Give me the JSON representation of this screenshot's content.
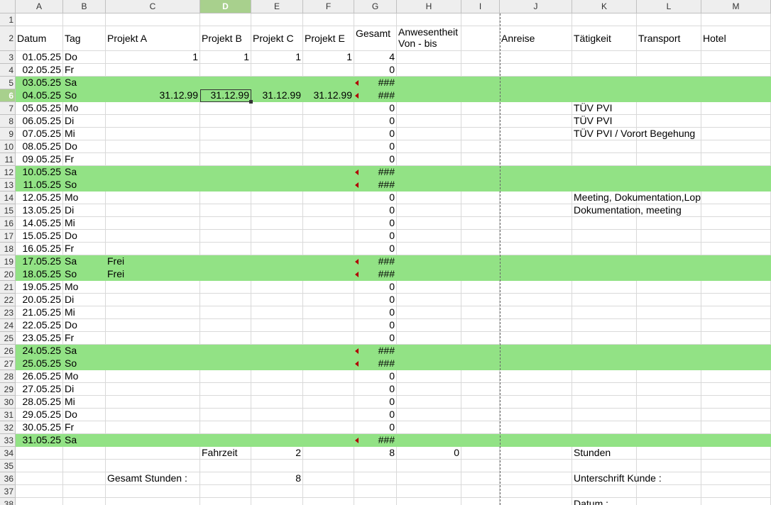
{
  "columns": [
    "A",
    "B",
    "C",
    "D",
    "E",
    "F",
    "G",
    "H",
    "I",
    "J",
    "K",
    "L",
    "M"
  ],
  "selected_column": "D",
  "selected_row": "6",
  "header_row": {
    "datum": "Datum",
    "tag": "Tag",
    "proj_a": "Projekt A",
    "proj_b": "Projekt B",
    "proj_c": "Projekt C",
    "proj_e": "Projekt E",
    "gesamt": "Gesamt",
    "anwesenheit": "Anwesentheit",
    "von_bis": "Von - bis",
    "anreise": "Anreise",
    "taetigkeit": "Tätigkeit",
    "transport": "Transport",
    "hotel": "Hotel"
  },
  "rows": [
    {
      "n": "1"
    },
    {
      "n": "2"
    },
    {
      "n": "3",
      "date": "01.05.25",
      "day": "Do",
      "a": "1",
      "b": "1",
      "c": "1",
      "e": "1",
      "g": "4"
    },
    {
      "n": "4",
      "date": "02.05.25",
      "day": "Fr",
      "g": "0"
    },
    {
      "n": "5",
      "date": "03.05.25",
      "day": "Sa",
      "g": "###",
      "weekend": true
    },
    {
      "n": "6",
      "date": "04.05.25",
      "day": "So",
      "a": "31.12.99",
      "b": "31.12.99",
      "c": "31.12.99",
      "e": "31.12.99",
      "g": "###",
      "weekend": true
    },
    {
      "n": "7",
      "date": "05.05.25",
      "day": "Mo",
      "g": "0",
      "k": "TÜV PVI"
    },
    {
      "n": "8",
      "date": "06.05.25",
      "day": "Di",
      "g": "0",
      "k": "TÜV PVI"
    },
    {
      "n": "9",
      "date": "07.05.25",
      "day": "Mi",
      "g": "0",
      "k": "TÜV PVI / Vorort Begehung"
    },
    {
      "n": "10",
      "date": "08.05.25",
      "day": "Do",
      "g": "0"
    },
    {
      "n": "11",
      "date": "09.05.25",
      "day": "Fr",
      "g": "0"
    },
    {
      "n": "12",
      "date": "10.05.25",
      "day": "Sa",
      "g": "###",
      "weekend": true
    },
    {
      "n": "13",
      "date": "11.05.25",
      "day": "So",
      "g": "###",
      "weekend": true
    },
    {
      "n": "14",
      "date": "12.05.25",
      "day": "Mo",
      "g": "0",
      "k": "Meeting, Dokumentation,Lop"
    },
    {
      "n": "15",
      "date": "13.05.25",
      "day": "Di",
      "g": "0",
      "k": "Dokumentation, meeting"
    },
    {
      "n": "16",
      "date": "14.05.25",
      "day": "Mi",
      "g": "0"
    },
    {
      "n": "17",
      "date": "15.05.25",
      "day": "Do",
      "g": "0"
    },
    {
      "n": "18",
      "date": "16.05.25",
      "day": "Fr",
      "g": "0"
    },
    {
      "n": "19",
      "date": "17.05.25",
      "day": "Sa",
      "a_text": "Frei",
      "g": "###",
      "weekend": true
    },
    {
      "n": "20",
      "date": "18.05.25",
      "day": "So",
      "a_text": "Frei",
      "g": "###",
      "weekend": true
    },
    {
      "n": "21",
      "date": "19.05.25",
      "day": "Mo",
      "g": "0"
    },
    {
      "n": "22",
      "date": "20.05.25",
      "day": "Di",
      "g": "0"
    },
    {
      "n": "23",
      "date": "21.05.25",
      "day": "Mi",
      "g": "0"
    },
    {
      "n": "24",
      "date": "22.05.25",
      "day": "Do",
      "g": "0"
    },
    {
      "n": "25",
      "date": "23.05.25",
      "day": "Fr",
      "g": "0"
    },
    {
      "n": "26",
      "date": "24.05.25",
      "day": "Sa",
      "g": "###",
      "weekend": true
    },
    {
      "n": "27",
      "date": "25.05.25",
      "day": "So",
      "g": "###",
      "weekend": true
    },
    {
      "n": "28",
      "date": "26.05.25",
      "day": "Mo",
      "g": "0"
    },
    {
      "n": "29",
      "date": "27.05.25",
      "day": "Di",
      "g": "0"
    },
    {
      "n": "30",
      "date": "28.05.25",
      "day": "Mi",
      "g": "0"
    },
    {
      "n": "31",
      "date": "29.05.25",
      "day": "Do",
      "g": "0"
    },
    {
      "n": "32",
      "date": "30.05.25",
      "day": "Fr",
      "g": "0"
    },
    {
      "n": "33",
      "date": "31.05.25",
      "day": "Sa",
      "g": "###",
      "weekend": true
    },
    {
      "n": "34",
      "b_text": "Fahrzeit",
      "c": "2",
      "g": "8",
      "h": "0",
      "k": "Stunden"
    },
    {
      "n": "35"
    },
    {
      "n": "36",
      "a_text": "Gesamt Stunden :",
      "c": "8",
      "k": "Unterschrift Kunde :"
    },
    {
      "n": "37"
    },
    {
      "n": "38",
      "k": "Datum :"
    }
  ],
  "colors": {
    "weekend_fill": "#92e285",
    "selection_header": "#a8d08d",
    "marker": "#b00000"
  }
}
